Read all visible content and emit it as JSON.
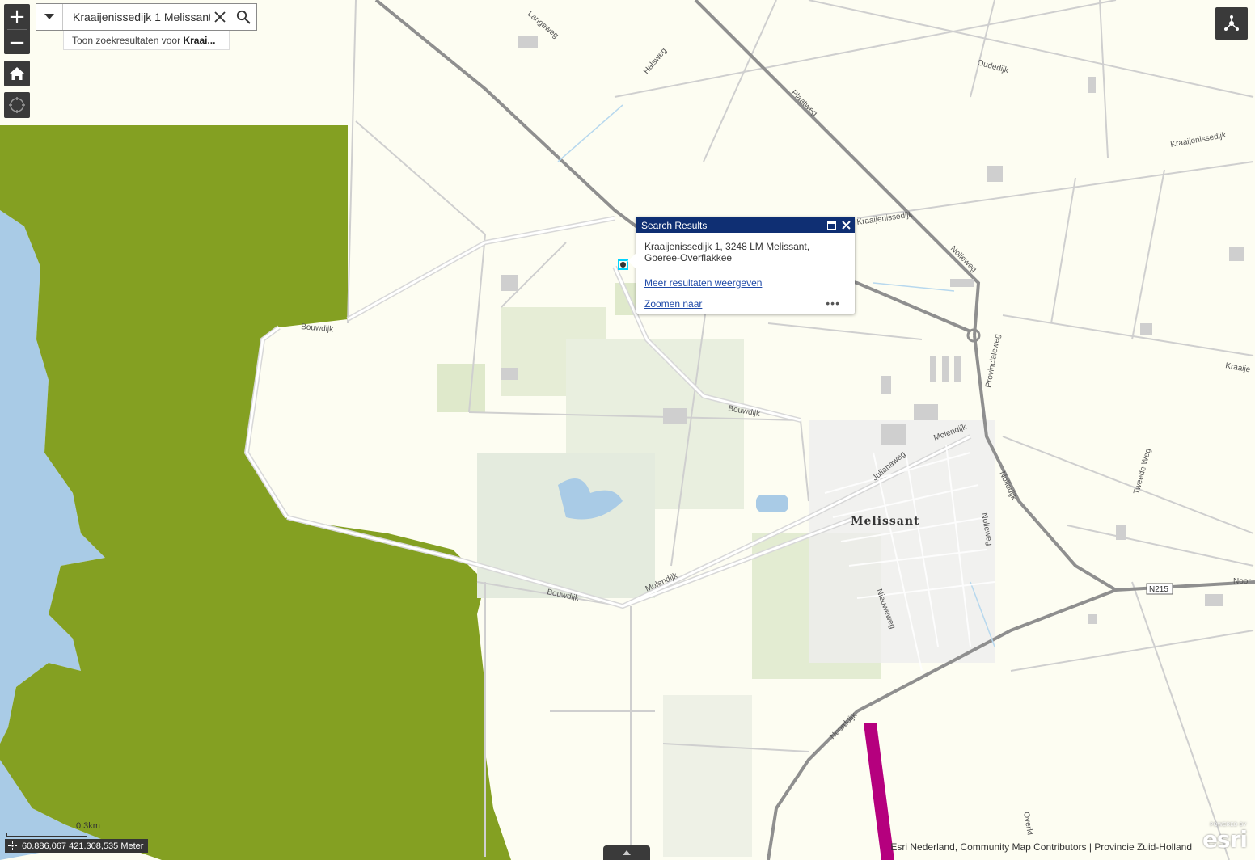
{
  "search": {
    "value": "Kraaijenissedijk 1 Melissant",
    "suggestion_prefix": "Toon zoekresultaten voor",
    "suggestion_term": "Kraai..."
  },
  "popup": {
    "title": "Search Results",
    "address_line1": "Kraaijenissedijk 1, 3248 LM Melissant,",
    "address_line2": "Goeree-Overflakkee",
    "more_results": "Meer resultaten weergeven",
    "zoom_to": "Zoomen naar",
    "menu": "•••"
  },
  "map": {
    "town": "Melissant",
    "road_labels": {
      "langeweg": "Langeweg",
      "halsweg": "Halsweg",
      "plaatweg": "Plaatweg",
      "oudedijk": "Oudedijk",
      "kraaijenissedijk_ne": "Kraaijenissedijk",
      "kraaijenissedijk_mid": "Kraaijenissedijk",
      "kraaijenissedijk_e": "Kraaije",
      "nolleweg_n": "Nolleweg",
      "provincialeweg": "Provincialeweg",
      "bouwdijk_w": "Bouwdijk",
      "bouwdijk_mid": "Bouwdijk",
      "bouwdijk_s": "Bouwdijk",
      "molendijk_e": "Molendijk",
      "molendijk_w": "Molendijk",
      "julianaweg": "Julianaweg",
      "nolledijk": "Nolledijk",
      "nolleweg_s": "Nolleweg",
      "tweede_weg": "Tweede Weg",
      "nieuweweg": "Nieuweweg",
      "noorddijk": "Noorddijk",
      "noord_e": "Noor",
      "n215": "N215",
      "overkl": "Overkl"
    },
    "colors": {
      "land": "#fdfdf2",
      "water": "#a9cbe6",
      "nature": "#84a022",
      "highlight": "#b5007e"
    }
  },
  "scale": {
    "label": "0.3km"
  },
  "coordinates": {
    "value": "60.886,067 421.308,535 Meter"
  },
  "attribution": {
    "text": "Esri Nederland, Community Map Contributors | Provincie Zuid-Holland"
  },
  "esri": {
    "powered": "POWERED BY",
    "logo": "esri"
  }
}
